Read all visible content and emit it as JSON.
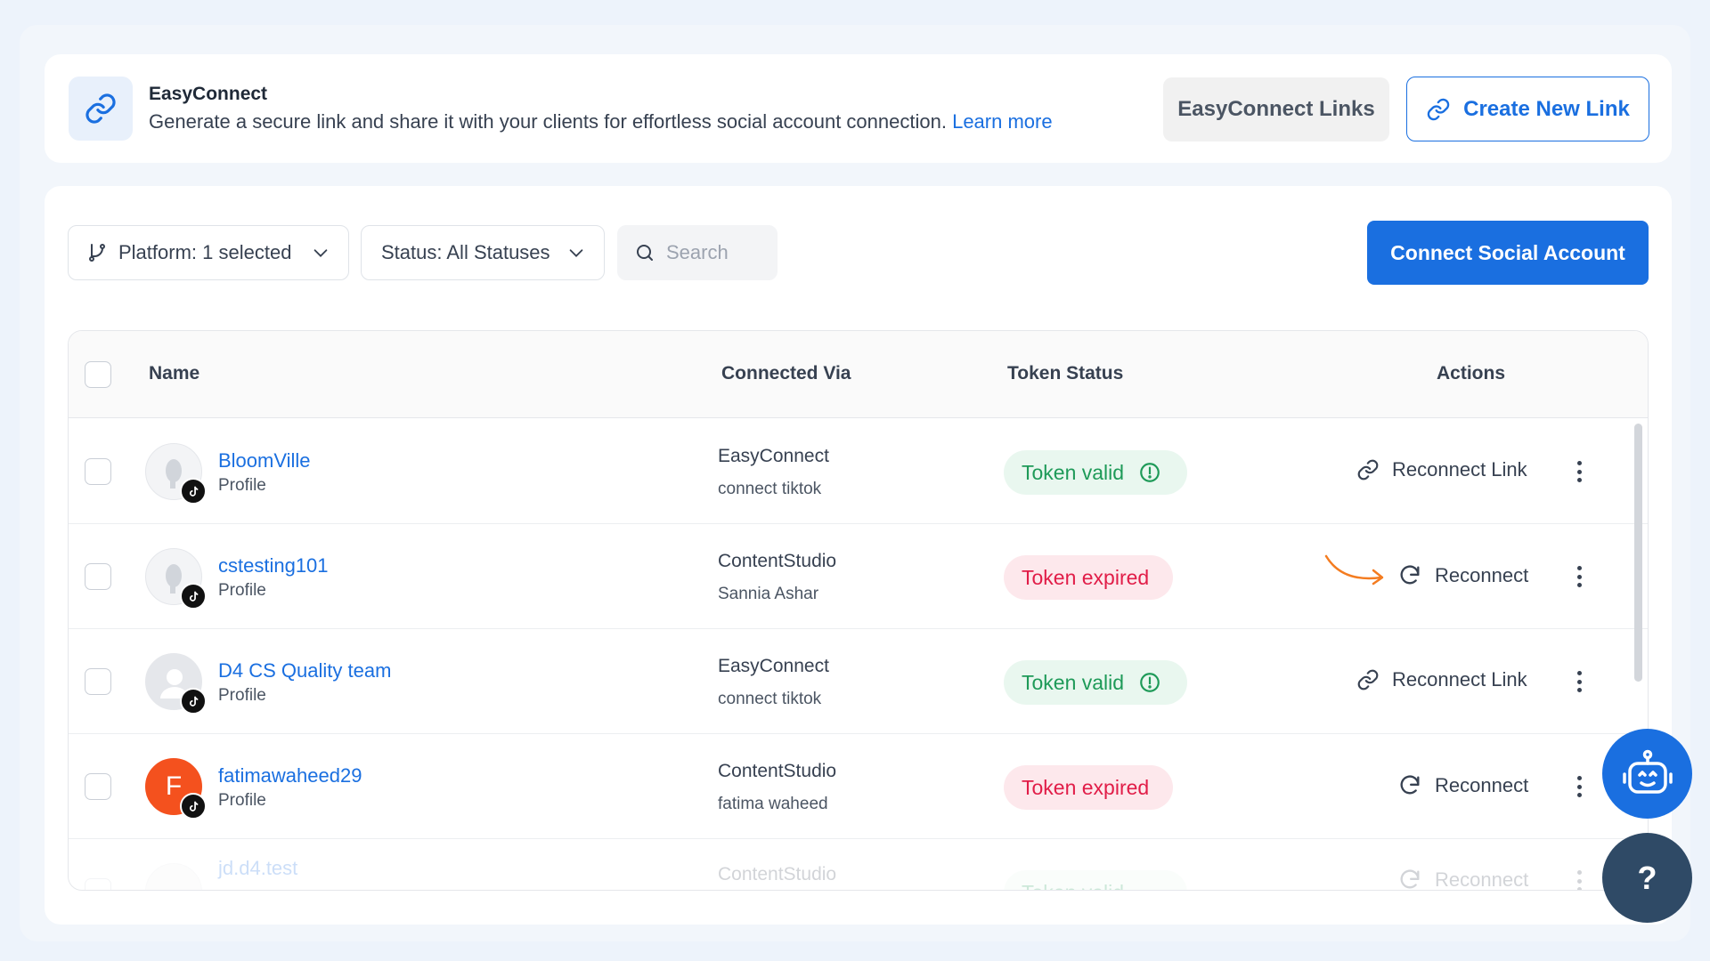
{
  "banner": {
    "title": "EasyConnect",
    "description": "Generate a secure link and share it with your clients for effortless social account connection.",
    "learn_more": "Learn more",
    "links_button": "EasyConnect Links",
    "create_button": "Create New Link"
  },
  "filters": {
    "platform": "Platform: 1 selected",
    "status": "Status: All Statuses",
    "search_placeholder": "Search"
  },
  "connect_button": "Connect Social Account",
  "table": {
    "columns": [
      "Name",
      "Connected Via",
      "Token Status",
      "Actions"
    ],
    "rows": [
      {
        "name": "BloomVille",
        "type": "Profile",
        "via": "EasyConnect",
        "via_detail": "connect tiktok",
        "status": "Token valid",
        "action": "Reconnect Link"
      },
      {
        "name": "cstesting101",
        "type": "Profile",
        "via": "ContentStudio",
        "via_detail": "Sannia Ashar",
        "status": "Token expired",
        "action": "Reconnect"
      },
      {
        "name": "D4 CS Quality team",
        "type": "Profile",
        "via": "EasyConnect",
        "via_detail": "connect tiktok",
        "status": "Token valid",
        "action": "Reconnect Link"
      },
      {
        "name": "fatimawaheed29",
        "type": "Profile",
        "avatar_letter": "F",
        "via": "ContentStudio",
        "via_detail": "fatima waheed",
        "status": "Token expired",
        "action": "Reconnect"
      },
      {
        "name": "jd.d4.test",
        "via": "ContentStudio",
        "status": "Token valid",
        "action": "Reconnect"
      }
    ]
  },
  "help_label": "?",
  "colors": {
    "brand": "#1a6fe0",
    "valid": "#1e9a58",
    "expired": "#e11d48",
    "arrow": "#f47c20"
  }
}
